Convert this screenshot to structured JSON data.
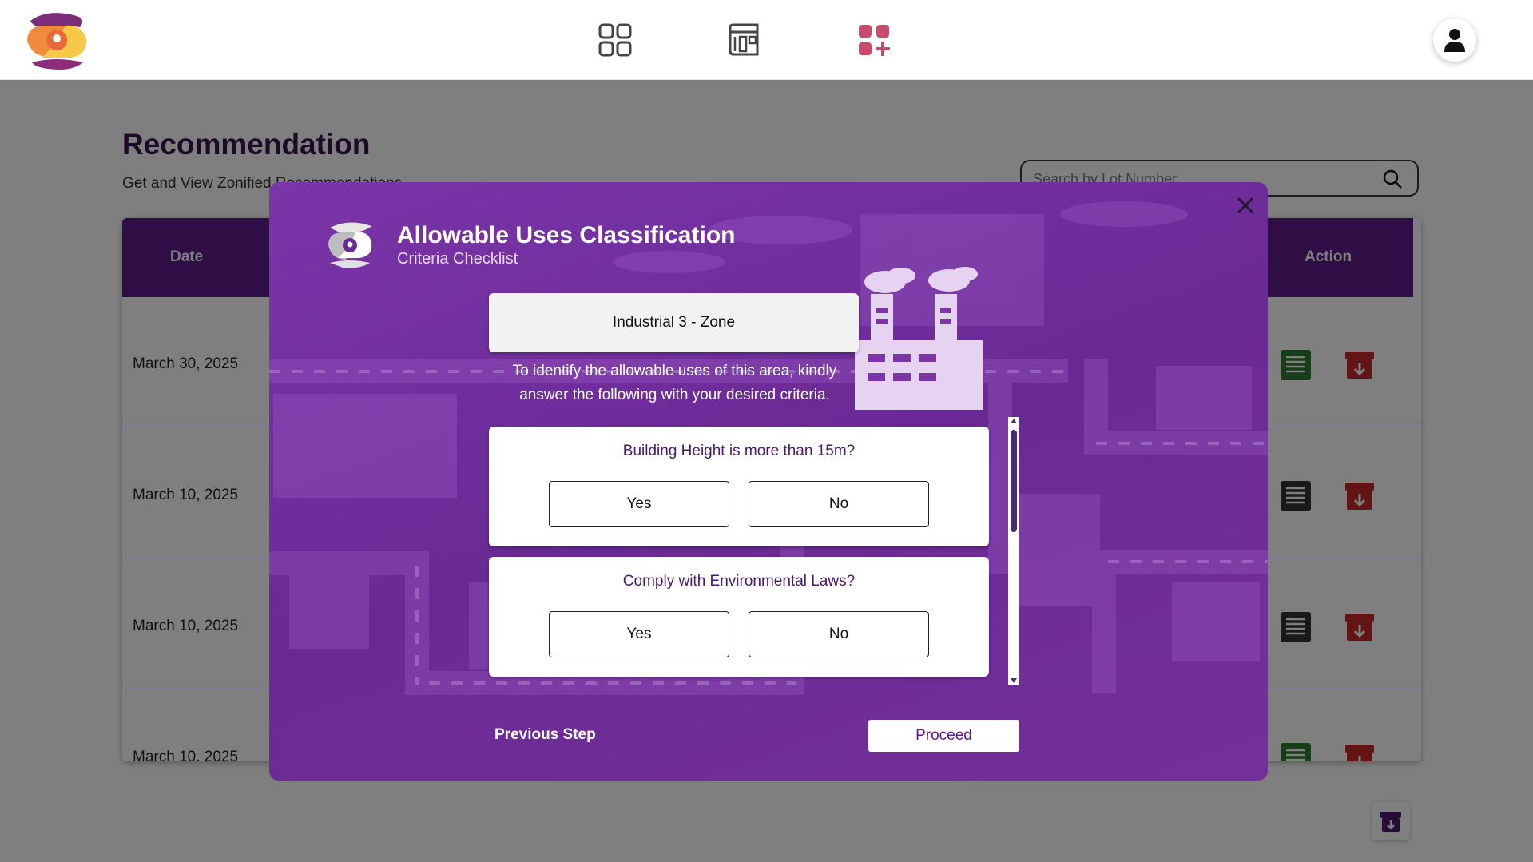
{
  "app": {
    "logo": "zonify-logo"
  },
  "nav": {
    "items": [
      {
        "icon": "grid-icon",
        "name": "dashboard"
      },
      {
        "icon": "blueprint-icon",
        "name": "zoning-map"
      },
      {
        "icon": "apps-add-icon",
        "name": "add-application",
        "active": true
      }
    ],
    "profile_icon": "user-icon"
  },
  "page": {
    "title": "Recommendation",
    "subtitle": "Get and View Zonified Recommendations",
    "search": {
      "placeholder": "Search by Lot Number"
    }
  },
  "table": {
    "columns": {
      "date": "Date",
      "action": "Action"
    },
    "rows": [
      {
        "date": "March 30, 2025",
        "doc_color": "#2e7d32"
      },
      {
        "date": "March 10, 2025",
        "doc_color": "#333333"
      },
      {
        "date": "March 10, 2025",
        "doc_color": "#333333"
      },
      {
        "date": "March 10, 2025",
        "doc_color": "#2e7d32"
      }
    ]
  },
  "modal": {
    "title": "Allowable Uses Classification",
    "subtitle": "Criteria Checklist",
    "zone": "Industrial 3 - Zone",
    "instructions": "To identify the allowable uses of this area, kindly answer the following with your desired criteria.",
    "questions": [
      {
        "text": "Building Height is more than 15m?",
        "yes": "Yes",
        "no": "No"
      },
      {
        "text": "Comply with Environmental Laws?",
        "yes": "Yes",
        "no": "No"
      }
    ],
    "previous_label": "Previous Step",
    "proceed_label": "Proceed"
  },
  "colors": {
    "brand_purple": "#5e1a8a",
    "modal_purple": "#7a35a8",
    "download_red": "#c62828"
  }
}
